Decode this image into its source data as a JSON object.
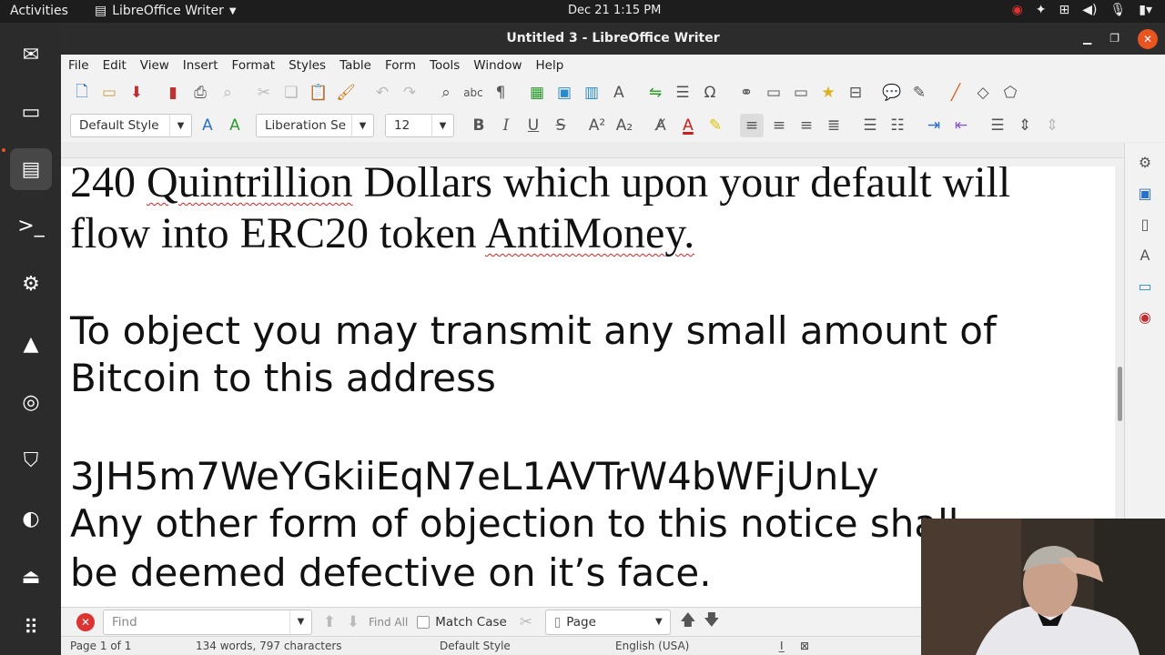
{
  "topbar": {
    "activities": "Activities",
    "app_name": "LibreOffice Writer",
    "clock": "Dec 21  1:15 PM"
  },
  "window": {
    "title": "Untitled 3 - LibreOffice Writer"
  },
  "menu": [
    "File",
    "Edit",
    "View",
    "Insert",
    "Format",
    "Styles",
    "Table",
    "Form",
    "Tools",
    "Window",
    "Help"
  ],
  "formatting": {
    "paragraph_style": "Default Style",
    "font_name": "Liberation Se",
    "font_size": "12"
  },
  "document": {
    "line1": "240 Quintrillion Dollars which upon your default will",
    "line2_pre": "flow into ERC20 token ",
    "line2_misspelled": "AntiMoney.",
    "line1_pre": "240 ",
    "line1_misspelled": "Quintrillion",
    "line1_post": " Dollars which upon your default will",
    "line3": "To object you may transmit any small amount of",
    "line4": "Bitcoin to this address",
    "line5": "3JH5m7WeYGkiiEqN7eL1AVTrW4bWFjUnLy",
    "line6": "Any other form of objection to this notice shall",
    "line7": "be deemed defective on it’s face."
  },
  "findbar": {
    "placeholder": "Find",
    "find_all": "Find All",
    "match_case": "Match Case",
    "search_by": "Page"
  },
  "statusbar": {
    "page": "Page 1 of 1",
    "counts": "134 words, 797 characters",
    "style": "Default Style",
    "language": "English (USA)"
  },
  "colors": {
    "accent": "#e95420",
    "font_color": "#c9211e",
    "highlight": "#ffff00"
  }
}
